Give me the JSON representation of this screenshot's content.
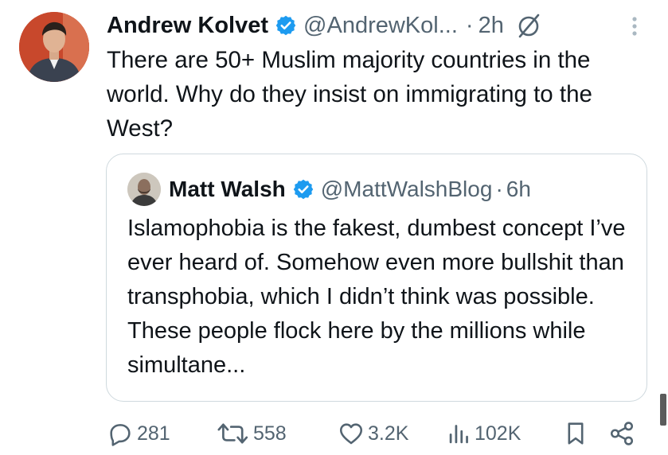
{
  "tweet": {
    "author_name": "Andrew Kolvet",
    "handle": "@AndrewKol...",
    "separator": "·",
    "time": "2h",
    "text": "There are 50+ Muslim majority countries in the world. Why do they insist on immigrating to the West?",
    "avatar_icon": "profile-photo",
    "verified_color": "#1d9bf0"
  },
  "quoted_tweet": {
    "author_name": "Matt Walsh",
    "handle": "@MattWalshBlog",
    "separator": "·",
    "time": "6h",
    "text": "Islamophobia is the fakest, dumbest concept I’ve ever heard of. Somehow even more bullshit than transphobia, which I didn’t think was possible. These people flock here by the millions while simultane...",
    "avatar_icon": "profile-photo"
  },
  "actions": {
    "replies": "281",
    "reposts": "558",
    "likes": "3.2K",
    "views": "102K"
  },
  "colors": {
    "text": "#0f1419",
    "secondary": "#536471",
    "border": "#cfd9de",
    "accent": "#1d9bf0"
  }
}
